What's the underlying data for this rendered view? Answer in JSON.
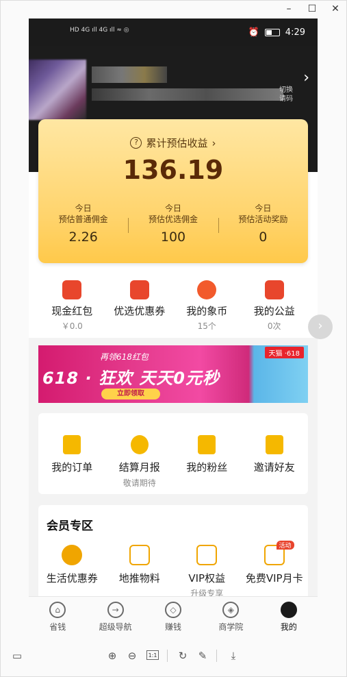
{
  "window": {
    "controls": [
      "–",
      "☐",
      "✕"
    ]
  },
  "status_bar": {
    "time": "4:29",
    "left_icons": "HD 4G ıll 4G ıll ≈ ◎"
  },
  "header": {
    "switch_line1": "切换",
    "switch_line2": "请码"
  },
  "earnings": {
    "title": "累计预估收益",
    "total": "136.19",
    "columns": [
      {
        "line1": "今日",
        "line2": "预估普通佣金",
        "value": "2.26"
      },
      {
        "line1": "今日",
        "line2": "预估优选佣金",
        "value": "100"
      },
      {
        "line1": "今日",
        "line2": "预估活动奖励",
        "value": "0"
      }
    ]
  },
  "quick_items": [
    {
      "label": "现金红包",
      "sub": "￥0.0",
      "icon": "red-packet-icon"
    },
    {
      "label": "优选优惠券",
      "sub": "",
      "icon": "coupon-icon"
    },
    {
      "label": "我的象币",
      "sub": "15个",
      "icon": "elephant-coin-icon"
    },
    {
      "label": "我的公益",
      "sub": "0次",
      "icon": "charity-heart-icon"
    }
  ],
  "banner": {
    "top_text": "再领618红包",
    "main_text": "618 · 狂欢  天天0元秒",
    "button": "立即领取",
    "tag": "天猫 ·618"
  },
  "tools": [
    {
      "label": "我的订单",
      "sub": "",
      "icon": "order-icon"
    },
    {
      "label": "结算月报",
      "sub": "敬请期待",
      "icon": "pie-chart-icon"
    },
    {
      "label": "我的粉丝",
      "sub": "",
      "icon": "fans-icon"
    },
    {
      "label": "邀请好友",
      "sub": "",
      "icon": "invite-icon"
    }
  ],
  "member": {
    "title": "会员专区",
    "items": [
      {
        "label": "生活优惠券",
        "sub": "",
        "icon": "life-coupon-icon",
        "badge": ""
      },
      {
        "label": "地推物料",
        "sub": "",
        "icon": "layers-icon",
        "badge": ""
      },
      {
        "label": "VIP权益",
        "sub": "升级专享",
        "icon": "vip-rights-icon",
        "badge": ""
      },
      {
        "label": "免费VIP月卡",
        "sub": "",
        "icon": "vip-card-icon",
        "badge": "活动"
      }
    ]
  },
  "tabbar": [
    {
      "label": "省钱",
      "icon": "home-icon",
      "glyph": "⌂",
      "active": false
    },
    {
      "label": "超级导航",
      "icon": "navigate-icon",
      "glyph": "→",
      "active": false
    },
    {
      "label": "赚钱",
      "icon": "diamond-icon",
      "glyph": "◇",
      "active": false
    },
    {
      "label": "商学院",
      "icon": "compass-icon",
      "glyph": "◈",
      "active": false
    },
    {
      "label": "我的",
      "icon": "profile-icon",
      "glyph": "",
      "active": true
    }
  ],
  "viewer_toolbar": {
    "zoom_in": "⊕",
    "zoom_out": "⊖",
    "actual_size": "1:1",
    "rotate": "↻",
    "edit": "✎",
    "download": "⤓",
    "panel": "▭"
  }
}
